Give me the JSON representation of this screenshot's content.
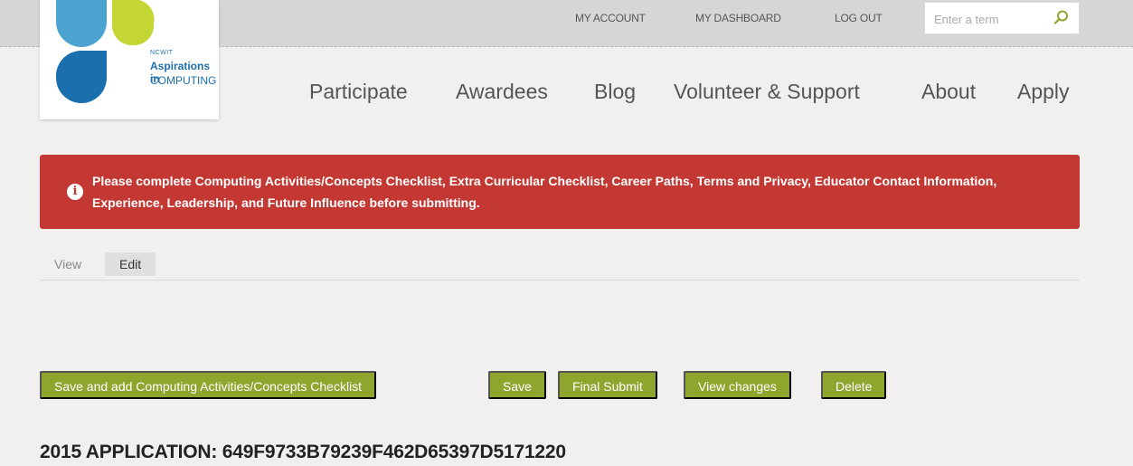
{
  "brand": {
    "small": "NCWIT",
    "line1": "Aspirations in",
    "line2": "COMPUTING",
    "colors": {
      "blue": "#1c6fae",
      "light_blue": "#4da3cf",
      "lime": "#c4d634"
    }
  },
  "utility_nav": {
    "account": "MY ACCOUNT",
    "dashboard": "MY DASHBOARD",
    "logout": "LOG OUT"
  },
  "search": {
    "placeholder": "Enter a term",
    "icon": "search-icon"
  },
  "main_nav": [
    "Participate",
    "Awardees",
    "Blog",
    "Volunteer & Support",
    "About",
    "Apply"
  ],
  "alert": {
    "icon": "info-icon",
    "text": "Please complete Computing Activities/Concepts Checklist, Extra Curricular Checklist, Career Paths, Terms and Privacy, Educator Contact Information, Experience, Leadership, and Future Influence before submitting.",
    "color": "#c43833"
  },
  "tabs": [
    "View",
    "Edit"
  ],
  "active_tab": "Edit",
  "actions": [
    "Save and add Computing Activities/Concepts Checklist",
    "Save",
    "Final Submit",
    "View changes",
    "Delete"
  ],
  "button_color": "#8ea52e",
  "application_title": "2015 APPLICATION: 649F9733B79239F462D65397D5171220"
}
